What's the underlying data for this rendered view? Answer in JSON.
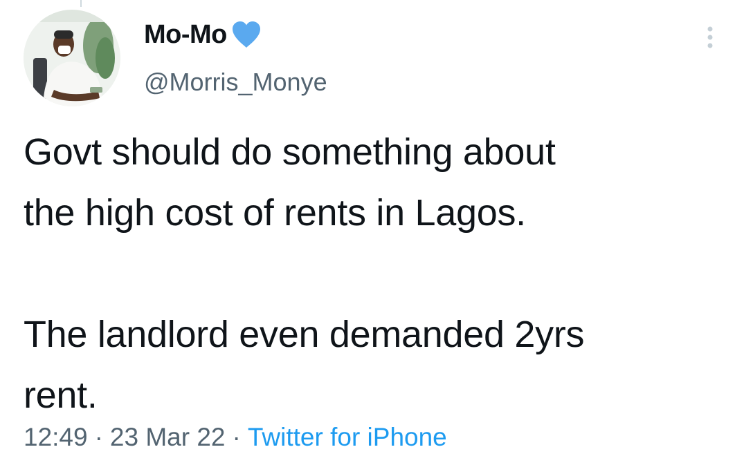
{
  "tweet": {
    "display_name": "Mo-Mo",
    "verified_badge": "blue-heart-icon",
    "handle": "@Morris_Monye",
    "text": "Govt should do something about\nthe high cost of rents in Lagos.\n\nThe landlord even demanded 2yrs\nrent.",
    "time": "12:49",
    "date": "23 Mar 22",
    "separator": "·",
    "source": "Twitter for iPhone",
    "more_icon": "more-vertical-icon",
    "avatar_icon": "avatar-photo"
  },
  "colors": {
    "text_primary": "#0f1419",
    "text_secondary": "#536471",
    "link_blue": "#1d9bf0",
    "heart_blue": "#5aa9ef"
  }
}
